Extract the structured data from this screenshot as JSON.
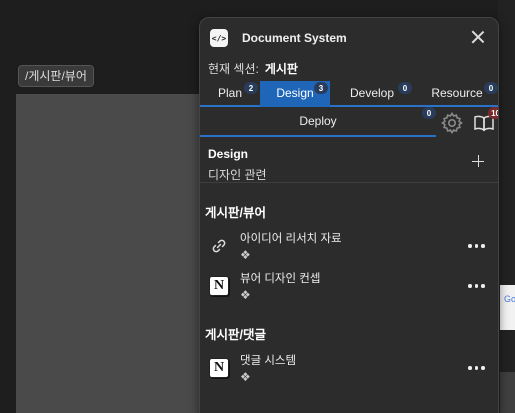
{
  "background": {
    "path_chip": "/게시판/뷰어",
    "side_card_text": "Go"
  },
  "panel": {
    "logo_text": "</>",
    "title": "Document System",
    "section_label": "현재 섹션:",
    "section_value": "게시판",
    "tabs": [
      {
        "label": "Plan",
        "count": "2"
      },
      {
        "label": "Design",
        "count": "3",
        "active": true
      },
      {
        "label": "Develop",
        "count": "0"
      },
      {
        "label": "Resource",
        "count": "0"
      }
    ],
    "deploy": {
      "label": "Deploy",
      "count": "0"
    },
    "book_count": "10",
    "description": {
      "title": "Design",
      "subtitle": "디자인 관련"
    },
    "groups": [
      {
        "title": "게시판/뷰어",
        "items": [
          {
            "name": "아이디어 리서치 자료",
            "sub": "❖",
            "icon": "link-icon"
          },
          {
            "name": "뷰어 디자인 컨셉",
            "sub": "❖",
            "icon": "notion-icon"
          }
        ]
      },
      {
        "title": "게시판/댓글",
        "items": [
          {
            "name": "댓글 시스템",
            "sub": "❖",
            "icon": "notion-icon"
          }
        ]
      }
    ],
    "notion_letter": "N"
  },
  "colors": {
    "accent": "#1f66b8",
    "panel_bg": "#2c2c2c",
    "badge_red": "#7a2a2a"
  }
}
